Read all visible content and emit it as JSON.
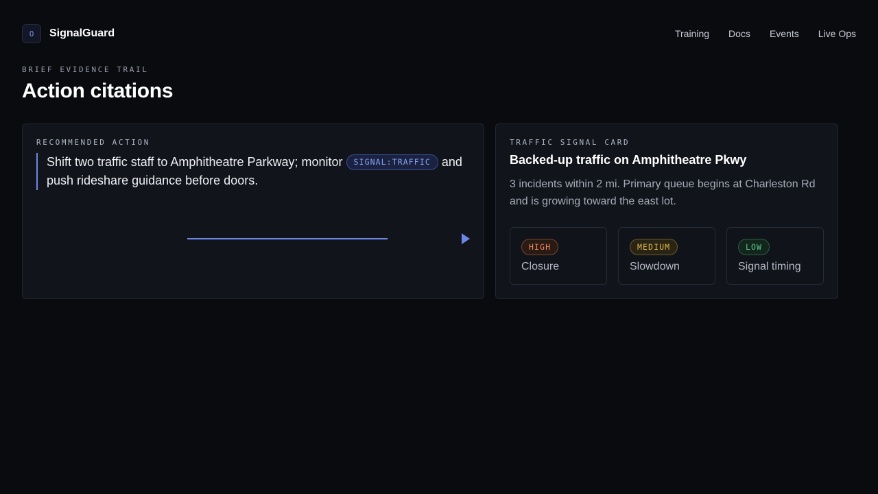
{
  "app": {
    "logo_glyph": "O",
    "name": "SignalGuard"
  },
  "nav": [
    "Training",
    "Docs",
    "Events",
    "Live Ops"
  ],
  "header": {
    "eyebrow": "BRIEF EVIDENCE TRAIL",
    "title": "Action citations"
  },
  "recommended": {
    "label": "RECOMMENDED ACTION",
    "text_before": "Shift two traffic staff to Amphitheatre Parkway; monitor ",
    "chip": "SIGNAL:TRAFFIC",
    "text_after": " and push rideshare guidance before doors.",
    "accent_color": "#6e86e6"
  },
  "signal_card": {
    "label": "TRAFFIC SIGNAL CARD",
    "title": "Backed-up traffic on Amphitheatre Pkwy",
    "description": "3 incidents within 2 mi. Primary queue begins at Charleston Rd and is growing toward the east lot.",
    "tiles": [
      {
        "severity": "HIGH",
        "name": "Closure",
        "color": "#f08a5d"
      },
      {
        "severity": "MEDIUM",
        "name": "Slowdown",
        "color": "#e2b84a"
      },
      {
        "severity": "LOW",
        "name": "Signal timing",
        "color": "#5ec48a"
      }
    ]
  }
}
